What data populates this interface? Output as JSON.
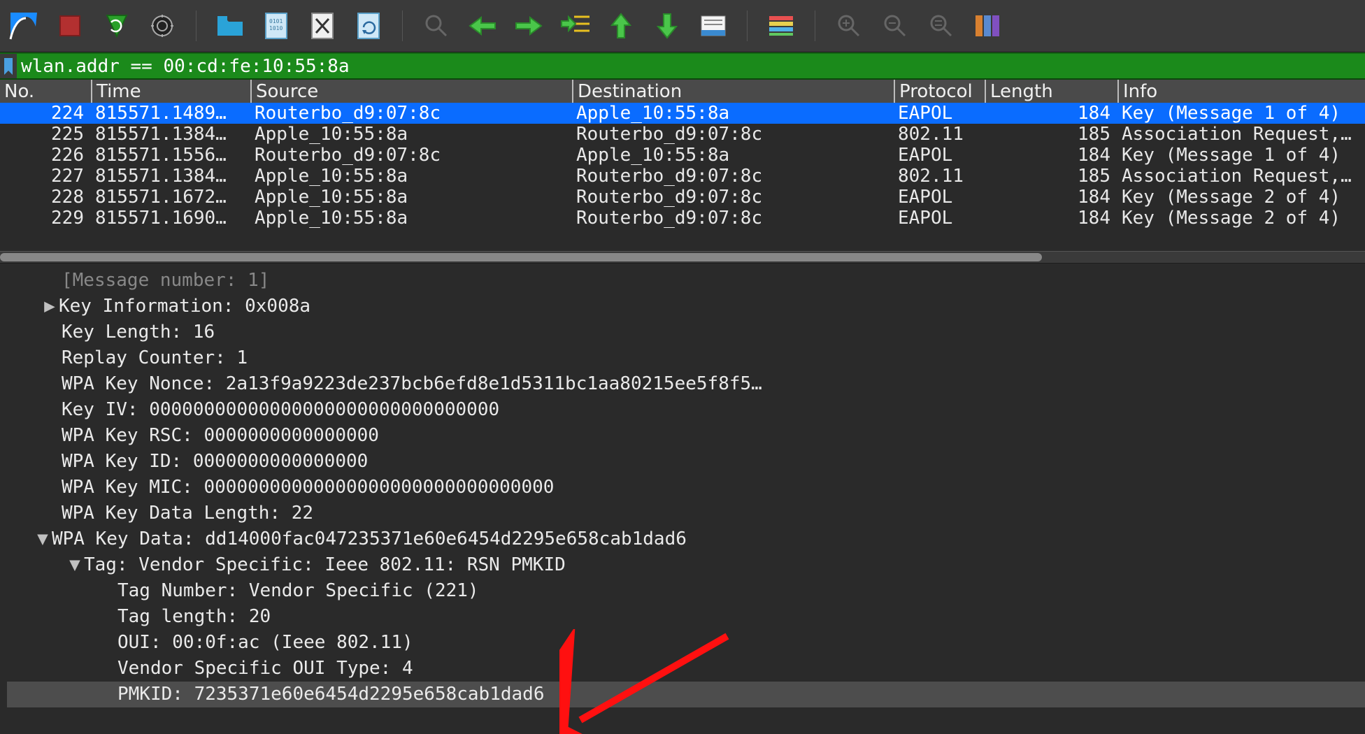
{
  "filter": {
    "value": "wlan.addr == 00:cd:fe:10:55:8a"
  },
  "columns": {
    "no": "No.",
    "time": "Time",
    "source": "Source",
    "destination": "Destination",
    "protocol": "Protocol",
    "length": "Length",
    "info": "Info"
  },
  "packets": [
    {
      "no": "224",
      "time": "815571.1489…",
      "src": "Routerbo_d9:07:8c",
      "dst": "Apple_10:55:8a",
      "proto": "EAPOL",
      "len": "184",
      "info": "Key (Message 1 of 4)",
      "selected": true
    },
    {
      "no": "225",
      "time": "815571.1384…",
      "src": "Apple_10:55:8a",
      "dst": "Routerbo_d9:07:8c",
      "proto": "802.11",
      "len": "185",
      "info": "Association Request, SN",
      "selected": false
    },
    {
      "no": "226",
      "time": "815571.1556…",
      "src": "Routerbo_d9:07:8c",
      "dst": "Apple_10:55:8a",
      "proto": "EAPOL",
      "len": "184",
      "info": "Key (Message 1 of 4)",
      "selected": false
    },
    {
      "no": "227",
      "time": "815571.1384…",
      "src": "Apple_10:55:8a",
      "dst": "Routerbo_d9:07:8c",
      "proto": "802.11",
      "len": "185",
      "info": "Association Request, SN",
      "selected": false
    },
    {
      "no": "228",
      "time": "815571.1672…",
      "src": "Apple_10:55:8a",
      "dst": "Routerbo_d9:07:8c",
      "proto": "EAPOL",
      "len": "184",
      "info": "Key (Message 2 of 4)",
      "selected": false
    },
    {
      "no": "229",
      "time": "815571.1690…",
      "src": "Apple_10:55:8a",
      "dst": "Routerbo_d9:07:8c",
      "proto": "EAPOL",
      "len": "184",
      "info": "Key (Message 2 of 4)",
      "selected": false
    }
  ],
  "details": {
    "truncated_top": "[Message number: 1]",
    "key_info_label": "Key Information: 0x008a",
    "key_len": "Key Length: 16",
    "replay": "Replay Counter: 1",
    "nonce": "WPA Key Nonce: 2a13f9a9223de237bcb6efd8e1d5311bc1aa80215ee5f8f5…",
    "iv": "Key IV: 00000000000000000000000000000000",
    "rsc": "WPA Key RSC: 0000000000000000",
    "keyid": "WPA Key ID: 0000000000000000",
    "mic": "WPA Key MIC: 00000000000000000000000000000000",
    "datalen": "WPA Key Data Length: 22",
    "data": "WPA Key Data: dd14000fac047235371e60e6454d2295e658cab1dad6",
    "tag": "Tag: Vendor Specific: Ieee 802.11: RSN PMKID",
    "tagnum": "Tag Number: Vendor Specific (221)",
    "taglen": "Tag length: 20",
    "oui": "OUI: 00:0f:ac (Ieee 802.11)",
    "ouitype": "Vendor Specific OUI Type: 4",
    "pmkid": "PMKID: 7235371e60e6454d2295e658cab1dad6"
  },
  "icons": {
    "logo": "wireshark-logo-icon",
    "stop": "stop-icon",
    "restart": "restart-icon",
    "options": "capture-options-icon",
    "open": "open-file-icon",
    "save": "save-file-icon",
    "close": "close-file-icon",
    "reload": "reload-icon",
    "find": "find-packet-icon",
    "prev": "go-previous-icon",
    "next": "go-next-icon",
    "goto": "go-to-packet-icon",
    "first": "go-first-icon",
    "last": "go-last-icon",
    "autoscroll": "autoscroll-icon",
    "colorize": "colorize-icon",
    "zoomin": "zoom-in-icon",
    "zoomout": "zoom-out-icon",
    "zoomreset": "zoom-reset-icon",
    "resize": "resize-columns-icon"
  }
}
